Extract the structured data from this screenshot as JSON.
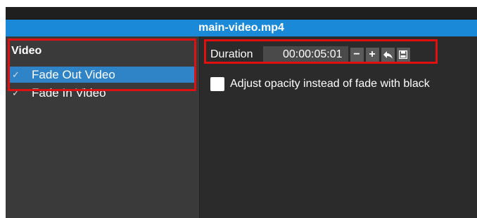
{
  "window": {
    "title": "main-video.mp4"
  },
  "sidebar": {
    "category": "Video",
    "items": [
      {
        "label": "Fade Out Video",
        "checked": true,
        "selected": true
      },
      {
        "label": "Fade In Video",
        "checked": true,
        "selected": false
      }
    ]
  },
  "properties": {
    "duration_label": "Duration",
    "duration_value": "00:00:05:01",
    "buttons": {
      "decrease": "−",
      "increase": "+",
      "reset_icon": "undo-arrow-icon",
      "save_icon": "save-icon"
    },
    "opacity_option": {
      "label": "Adjust opacity instead of fade with black",
      "checked": false
    }
  },
  "colors": {
    "accent": "#1a8ad8",
    "selection": "#2f84c8",
    "annotation": "#e01010"
  }
}
